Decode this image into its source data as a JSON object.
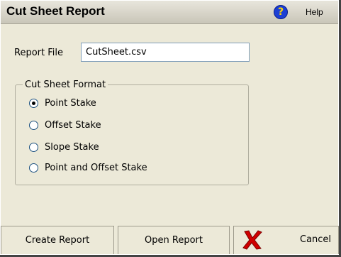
{
  "titlebar": {
    "title": "Cut Sheet Report",
    "help_label": "Help",
    "help_icon": "question-circle-icon",
    "help_glyph": "?"
  },
  "report_file": {
    "label": "Report File",
    "value": "CutSheet.csv"
  },
  "format": {
    "legend": "Cut Sheet Format",
    "selected": "Point Stake",
    "options": [
      "Point Stake",
      "Offset Stake",
      "Slope Stake",
      "Point and Offset Stake"
    ]
  },
  "buttons": {
    "create": "Create Report",
    "open": "Open Report",
    "cancel": "Cancel",
    "cancel_icon": "red-x-icon"
  },
  "colors": {
    "window_bg": "#ece9d8",
    "cancel_icon": "#d00000",
    "help_icon_bg": "#1c3fd4"
  }
}
